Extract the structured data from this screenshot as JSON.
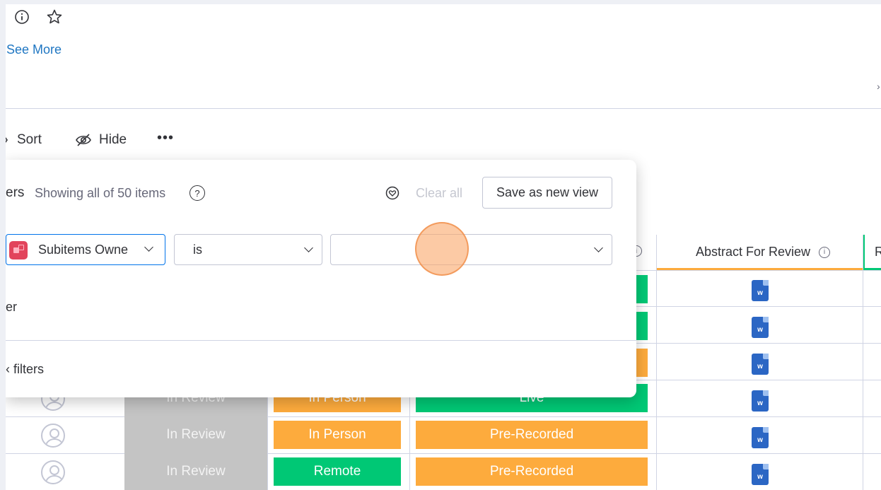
{
  "header": {
    "info_icon": "info-icon",
    "star_icon": "star-icon",
    "see_more": "See More"
  },
  "toolbar": {
    "sort_label": "Sort",
    "hide_label": "Hide",
    "more_label": "•••"
  },
  "filter_panel": {
    "title_fragment": "ers",
    "showing_text": "Showing all of 50 items",
    "clear_all": "Clear all",
    "save_view": "Save as new view",
    "column_select": "Subitems Owne",
    "condition_select": "is",
    "value_select": "",
    "row_fragment": "er",
    "advanced_fragment": "‹ filters"
  },
  "table": {
    "headers": {
      "abstract": "Abstract For Review",
      "next_fragment": "R"
    },
    "rows": [
      {
        "status": "In Review",
        "format": "In Person",
        "recording": "Live",
        "format_color": "#fdab3d",
        "recording_color": "#00c875"
      },
      {
        "status": "In Review",
        "format": "In Person",
        "recording": "Pre-Recorded",
        "format_color": "#fdab3d",
        "recording_color": "#fdab3d"
      },
      {
        "status": "In Review",
        "format": "Remote",
        "recording": "Pre-Recorded",
        "format_color": "#00c875",
        "recording_color": "#fdab3d"
      }
    ],
    "hidden_row_colors": [
      "#00c875",
      "#00c875",
      "#fdab3d"
    ],
    "doc_icon_label": "w"
  },
  "colors": {
    "accent": "#0073ea",
    "green": "#00c875",
    "orange": "#fdab3d",
    "status_gray": "#c4c4c4"
  }
}
